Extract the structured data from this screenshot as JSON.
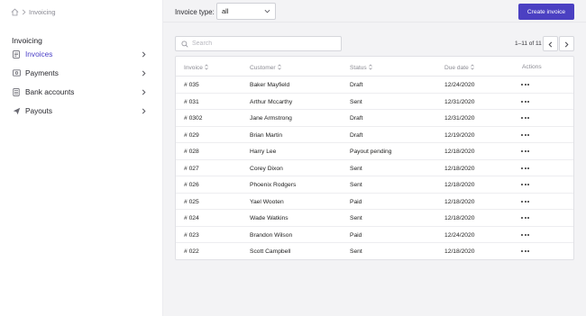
{
  "breadcrumb": {
    "current": "Invoicing"
  },
  "sidebar": {
    "section_title": "Invoicing",
    "items": [
      {
        "label": "Invoices",
        "icon": "document-icon",
        "active": true
      },
      {
        "label": "Payments",
        "icon": "payment-icon",
        "active": false
      },
      {
        "label": "Bank accounts",
        "icon": "bank-icon",
        "active": false
      },
      {
        "label": "Payouts",
        "icon": "send-icon",
        "active": false
      }
    ]
  },
  "toolbar": {
    "filter_label": "Invoice type:",
    "filter_value": "all",
    "create_label": "Create invoice"
  },
  "search": {
    "placeholder": "Search"
  },
  "pagination": {
    "text": "1–11 of 11"
  },
  "table": {
    "headers": [
      "Invoice",
      "Customer",
      "Status",
      "Due date",
      "Actions"
    ],
    "rows": [
      {
        "invoice": "# 035",
        "customer": "Baker Mayfield",
        "status": "Draft",
        "due": "12/24/2020"
      },
      {
        "invoice": "# 031",
        "customer": "Arthur Mccarthy",
        "status": "Sent",
        "due": "12/31/2020"
      },
      {
        "invoice": "# 0302",
        "customer": "Jane Armstrong",
        "status": "Draft",
        "due": "12/31/2020"
      },
      {
        "invoice": "# 029",
        "customer": "Brian Martin",
        "status": "Draft",
        "due": "12/19/2020"
      },
      {
        "invoice": "# 028",
        "customer": "Harry Lee",
        "status": "Payout pending",
        "due": "12/18/2020"
      },
      {
        "invoice": "# 027",
        "customer": "Corey Dixon",
        "status": "Sent",
        "due": "12/18/2020"
      },
      {
        "invoice": "# 026",
        "customer": "Phoenix Rodgers",
        "status": "Sent",
        "due": "12/18/2020"
      },
      {
        "invoice": "# 025",
        "customer": "Yael Wooten",
        "status": "Paid",
        "due": "12/18/2020"
      },
      {
        "invoice": "# 024",
        "customer": "Wade Watkins",
        "status": "Sent",
        "due": "12/18/2020"
      },
      {
        "invoice": "# 023",
        "customer": "Brandon Wilson",
        "status": "Paid",
        "due": "12/24/2020"
      },
      {
        "invoice": "# 022",
        "customer": "Scott Campbell",
        "status": "Sent",
        "due": "12/18/2020"
      }
    ]
  },
  "colors": {
    "accent": "#4b40c2",
    "sidebar_bg": "#ffffff",
    "page_bg": "#f3f3f5"
  }
}
